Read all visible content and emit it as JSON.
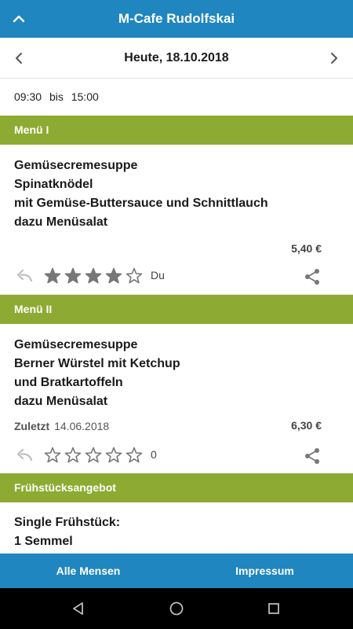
{
  "app": {
    "title": "M-Cafe Rudolfskai"
  },
  "date_bar": {
    "date": "Heute, 18.10.2018"
  },
  "hours": {
    "from": "09:30",
    "sep": "bis",
    "to": "15:00"
  },
  "menus": [
    {
      "header": "Menü I",
      "lines": [
        "Gemüsecremesuppe",
        "Spinatknödel",
        "mit Gemüse-Buttersauce und Schnittlauch",
        "dazu Menüsalat"
      ],
      "price": "5,40 €",
      "rating": {
        "value": 4,
        "max": 5,
        "label": "Du"
      }
    },
    {
      "header": "Menü II",
      "lines": [
        "Gemüsecremesuppe",
        "Berner Würstel mit Ketchup",
        "und Bratkartoffeln",
        "dazu Menüsalat"
      ],
      "last_label": "Zuletzt",
      "last_date": "14.06.2018",
      "price": "6,30 €",
      "rating": {
        "value": 0,
        "max": 5,
        "label": "0"
      }
    },
    {
      "header": "Frühstücksangebot",
      "lines": [
        "Single Frühstück:",
        "1 Semmel"
      ]
    }
  ],
  "bottom_nav": {
    "left": "Alle Mensen",
    "right": "Impressum"
  },
  "colors": {
    "primary": "#1f86bf",
    "section": "#8dab32",
    "icon_grey": "#777777"
  },
  "icons": [
    "chevron-up-icon",
    "chevron-left-icon",
    "chevron-right-icon",
    "undo-icon",
    "star-icon",
    "share-icon",
    "back-triangle-icon",
    "home-circle-icon",
    "recents-square-icon"
  ]
}
